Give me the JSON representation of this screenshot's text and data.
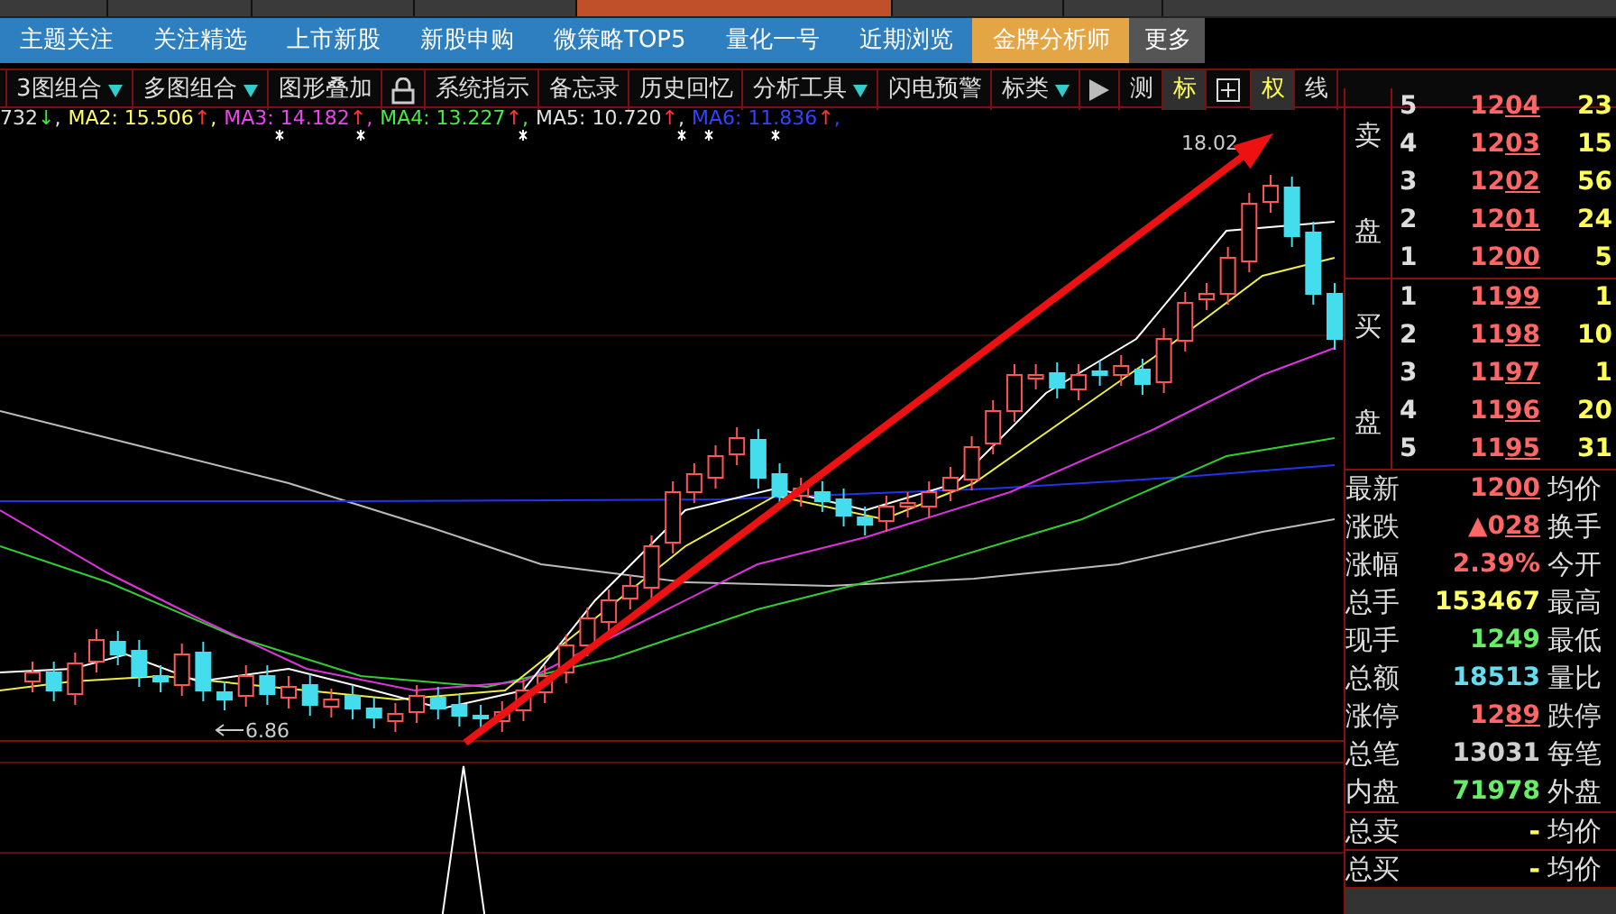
{
  "nav": [
    {
      "label": "主题关注",
      "selected": false,
      "kind": "tab"
    },
    {
      "label": "关注精选",
      "selected": false,
      "kind": "tab"
    },
    {
      "label": "上市新股",
      "selected": false,
      "kind": "tab"
    },
    {
      "label": "新股申购",
      "selected": false,
      "kind": "tab"
    },
    {
      "label": "微策略TOP5",
      "selected": false,
      "kind": "tab"
    },
    {
      "label": "量化一号",
      "selected": false,
      "kind": "tab"
    },
    {
      "label": "近期浏览",
      "selected": false,
      "kind": "tab"
    },
    {
      "label": "金牌分析师",
      "selected": true,
      "kind": "tab"
    },
    {
      "label": "更多",
      "selected": false,
      "kind": "more"
    }
  ],
  "toolbar": [
    {
      "kind": "dropdown",
      "label": "3图组合"
    },
    {
      "kind": "dropdown",
      "label": "多图组合"
    },
    {
      "kind": "button",
      "label": "图形叠加"
    },
    {
      "kind": "lock"
    },
    {
      "kind": "button",
      "label": "系统指示"
    },
    {
      "kind": "button",
      "label": "备忘录"
    },
    {
      "kind": "button",
      "label": "历史回忆"
    },
    {
      "kind": "dropdown",
      "label": "分析工具"
    },
    {
      "kind": "button",
      "label": "闪电预警"
    },
    {
      "kind": "dropdown",
      "label": "标类"
    },
    {
      "kind": "play"
    },
    {
      "kind": "toggle",
      "label": "测",
      "active": false
    },
    {
      "kind": "toggle",
      "label": "标",
      "active": true
    },
    {
      "kind": "grid"
    },
    {
      "kind": "toggle",
      "label": "权",
      "active": true
    },
    {
      "kind": "toggle",
      "label": "线",
      "active": false
    }
  ],
  "ma_legend": [
    {
      "text": "732",
      "arrow": {
        "text": "↓",
        "color": "#33ee33"
      },
      "separator": ",",
      "color": "#e0e0e0"
    },
    {
      "text": "MA2: 15.506",
      "arrow": {
        "text": "↑",
        "color": "#ff3333"
      },
      "separator": ",",
      "color": "#ffff66"
    },
    {
      "text": "MA3: 14.182",
      "arrow": {
        "text": "↑",
        "color": "#ff3333"
      },
      "separator": ",",
      "color": "#ee44ee"
    },
    {
      "text": "MA4: 13.227",
      "arrow": {
        "text": "↑",
        "color": "#ff3333"
      },
      "separator": ",",
      "color": "#44ee44"
    },
    {
      "text": "MA5: 10.720",
      "arrow": {
        "text": "↑",
        "color": "#ff3333"
      },
      "separator": ",",
      "color": "#e0e0e0"
    },
    {
      "text": "MA6: 11.836",
      "arrow": {
        "text": "↑",
        "color": "#ff3333"
      },
      "separator": ",",
      "color": "#3344ff"
    }
  ],
  "chart": {
    "high_label": "18.02",
    "low_label": "6.86"
  },
  "order_book": {
    "sell_label": [
      "卖",
      "盘"
    ],
    "sell": [
      {
        "rank": "5",
        "price": "1204",
        "volume": "23"
      },
      {
        "rank": "4",
        "price": "1203",
        "volume": "15"
      },
      {
        "rank": "3",
        "price": "1202",
        "volume": "56"
      },
      {
        "rank": "2",
        "price": "1201",
        "volume": "24"
      },
      {
        "rank": "1",
        "price": "1200",
        "volume": "5"
      }
    ],
    "buy_label": [
      "买",
      "盘"
    ],
    "buy": [
      {
        "rank": "1",
        "price": "1199",
        "volume": "1"
      },
      {
        "rank": "2",
        "price": "1198",
        "volume": "10"
      },
      {
        "rank": "3",
        "price": "1197",
        "volume": "1"
      },
      {
        "rank": "4",
        "price": "1196",
        "volume": "20"
      },
      {
        "rank": "5",
        "price": "1195",
        "volume": "31"
      }
    ]
  },
  "quote": [
    {
      "label": "最新",
      "value": "1200",
      "color": "#ff6666",
      "underlined": true,
      "right_label": "均价"
    },
    {
      "label": "涨跌",
      "value": "▲028",
      "color": "#ff6666",
      "underlined": true,
      "right_label": "换手"
    },
    {
      "label": "涨幅",
      "value": "2.39%",
      "color": "#ff6666",
      "underlined": false,
      "right_label": "今开"
    },
    {
      "label": "总手",
      "value": "153467",
      "color": "#ffff66",
      "underlined": false,
      "right_label": "最高"
    },
    {
      "label": "现手",
      "value": "1249",
      "color": "#66ee66",
      "underlined": false,
      "right_label": "最低"
    },
    {
      "label": "总额",
      "value": "18513",
      "color": "#66ddee",
      "underlined": false,
      "right_label": "量比"
    },
    {
      "label": "涨停",
      "value": "1289",
      "color": "#ff6666",
      "underlined": true,
      "right_label": "跌停"
    },
    {
      "label": "总笔",
      "value": "13031",
      "color": "#d0d0d0",
      "underlined": false,
      "right_label": "每笔"
    },
    {
      "label": "内盘",
      "value": "71978",
      "color": "#66ee66",
      "underlined": false,
      "right_label": "外盘"
    }
  ],
  "totals": [
    {
      "label": "总卖",
      "value": "-",
      "right_label": "均价"
    },
    {
      "label": "总买",
      "value": "-",
      "right_label": "均价"
    }
  ]
}
